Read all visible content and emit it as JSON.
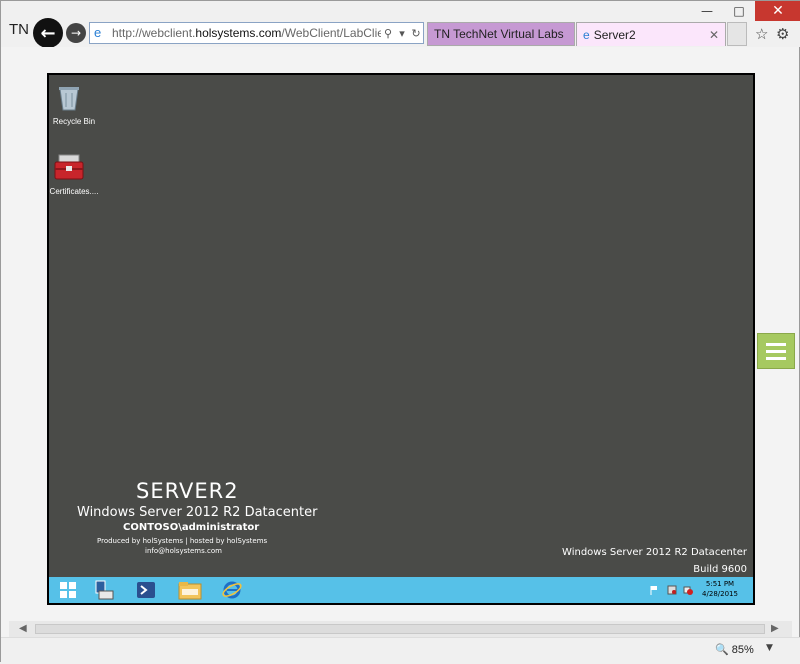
{
  "browser": {
    "logo_text": "TN",
    "address_prefix": "http://webclient.",
    "address_domain": "holsystems.com",
    "address_rest": "/WebClient/LabClient.as",
    "tabs": [
      {
        "label": "TN TechNet Virtual Labs"
      },
      {
        "label": "Server2"
      }
    ],
    "zoom": "85%"
  },
  "desktop": {
    "icons": [
      {
        "label": "Recycle Bin"
      },
      {
        "label": "Certificates...."
      }
    ],
    "server_name": "SERVER2",
    "os_name": "Windows Server 2012 R2 Datacenter",
    "user": "CONTOSO\\administrator",
    "produced_by": "Produced by holSystems | hosted by holSystems",
    "email": "info@holsystems.com",
    "watermark_line1": "Windows Server 2012 R2 Datacenter",
    "watermark_line2": "Build 9600"
  },
  "taskbar": {
    "time": "5:51 PM",
    "date": "4/28/2015"
  },
  "colors": {
    "desktop_bg": "#4a4b48",
    "taskbar": "#56c1e8",
    "tab_active": "#fbe6fb",
    "tab_inactive": "#c699d3",
    "side_tab": "#a6c960"
  }
}
